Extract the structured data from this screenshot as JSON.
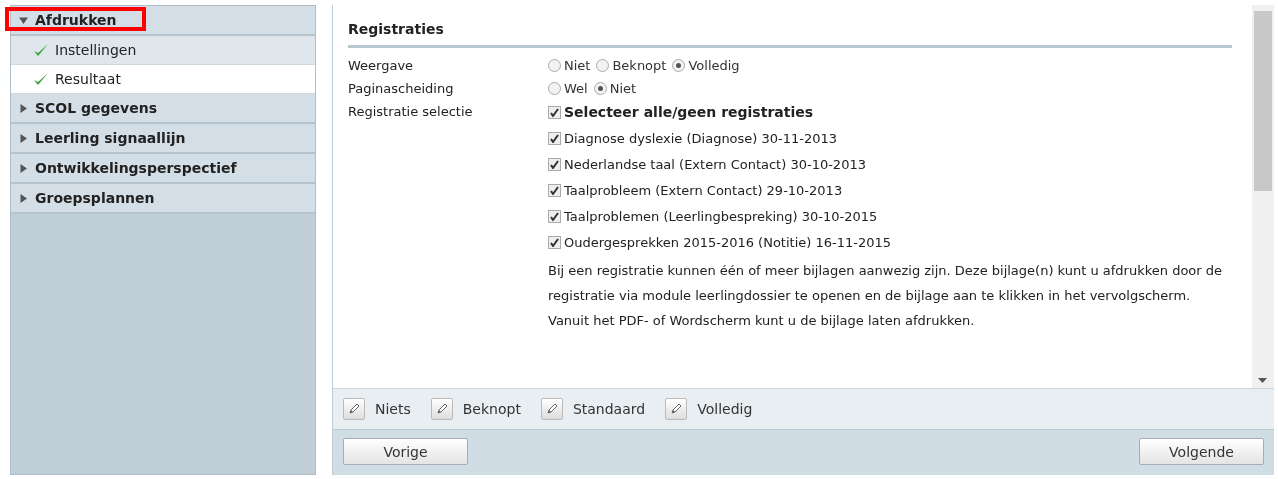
{
  "sidebar": {
    "groups": [
      {
        "label": "Afdrukken",
        "expanded": true,
        "highlighted": true,
        "children": [
          {
            "label": "Instellingen",
            "done": true,
            "selected": false
          },
          {
            "label": "Resultaat",
            "done": true,
            "selected": true
          }
        ]
      },
      {
        "label": "SCOL gegevens",
        "expanded": false,
        "highlighted": false
      },
      {
        "label": "Leerling signaallijn",
        "expanded": false,
        "highlighted": false
      },
      {
        "label": "Ontwikkelingsperspectief",
        "expanded": false,
        "highlighted": false
      },
      {
        "label": "Groepsplannen",
        "expanded": false,
        "highlighted": false
      }
    ]
  },
  "section": {
    "title": "Registraties",
    "radio_rows": [
      {
        "label": "Weergave",
        "options": [
          {
            "label": "Niet",
            "selected": false
          },
          {
            "label": "Beknopt",
            "selected": false
          },
          {
            "label": "Volledig",
            "selected": true
          }
        ]
      },
      {
        "label": "Paginascheiding",
        "options": [
          {
            "label": "Wel",
            "selected": false
          },
          {
            "label": "Niet",
            "selected": true
          }
        ]
      }
    ],
    "selection": {
      "label": "Registratie selectie",
      "select_all": {
        "label": "Selecteer alle/geen registraties",
        "checked": true
      },
      "items": [
        {
          "label": "Diagnose dyslexie (Diagnose) 30-11-2013",
          "checked": true
        },
        {
          "label": "Nederlandse taal (Extern Contact) 30-10-2013",
          "checked": true
        },
        {
          "label": "Taalprobleem (Extern Contact) 29-10-2013",
          "checked": true
        },
        {
          "label": "Taalproblemen (Leerlingbespreking) 30-10-2015",
          "checked": true
        },
        {
          "label": "Oudergesprekken 2015-2016 (Notitie) 16-11-2015",
          "checked": true
        }
      ]
    },
    "note": "Bij een registratie kunnen één of meer bijlagen aanwezig zijn. Deze bijlage(n) kunt u afdrukken door de registratie via module leerlingdossier te openen en de bijlage aan te klikken in het vervolgscherm. Vanuit het PDF- of Wordscherm kunt u de bijlage laten afdrukken."
  },
  "presets": [
    "Niets",
    "Beknopt",
    "Standaard",
    "Volledig"
  ],
  "navigation": {
    "previous": "Vorige",
    "next": "Volgende"
  }
}
